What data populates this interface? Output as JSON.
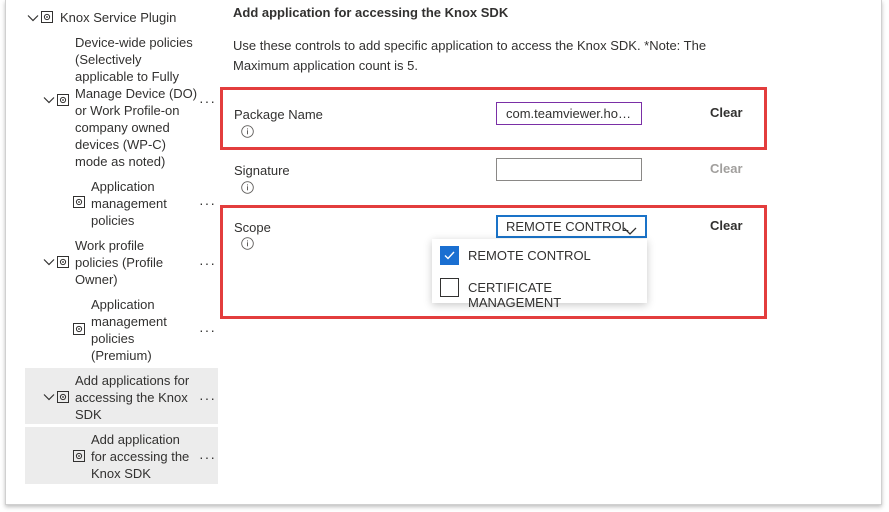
{
  "tree": {
    "root_label": "Knox Service Plugin",
    "items": [
      {
        "label": "Device-wide policies (Selectively applicable to Fully Manage Device (DO) or Work Profile-on company owned devices (WP-C) mode as noted)"
      },
      {
        "label": "Application management policies"
      },
      {
        "label": "Work profile policies (Profile Owner)"
      },
      {
        "label": "Application management policies (Premium)"
      },
      {
        "label": "Add applications for accessing the Knox SDK"
      },
      {
        "label": "Add application for accessing the Knox SDK"
      }
    ],
    "more_label": "···"
  },
  "main": {
    "title": "Add application for accessing the Knox SDK",
    "description": "Use these controls to add specific application to access the Knox SDK. *Note: The Maximum application count is 5.",
    "fields": {
      "package": {
        "label": "Package Name",
        "value": "com.teamviewer.hos...",
        "clear": "Clear"
      },
      "signature": {
        "label": "Signature",
        "value": "",
        "clear": "Clear"
      },
      "scope": {
        "label": "Scope",
        "value": "REMOTE CONTROL",
        "clear": "Clear"
      }
    },
    "scope_options": [
      {
        "label": "REMOTE CONTROL",
        "checked": true
      },
      {
        "label": "CERTIFICATE MANAGEMENT",
        "checked": false
      }
    ]
  },
  "colors": {
    "highlight": "#e33d3d",
    "accent": "#1a6fd1",
    "selected_row": "#ececec"
  }
}
